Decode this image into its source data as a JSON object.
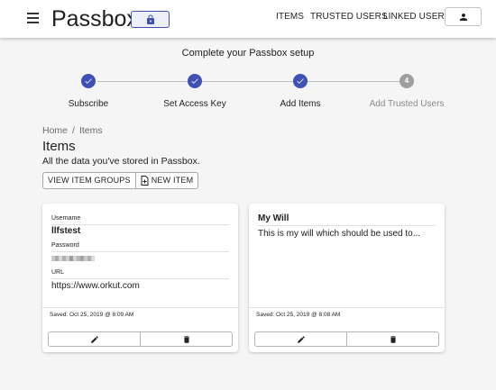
{
  "header": {
    "brand": "Passbox",
    "nav": {
      "items": "ITEMS",
      "trusted_users": "TRUSTED USERS",
      "linked_users": "LINKED USERS"
    }
  },
  "setup": {
    "title": "Complete your Passbox setup",
    "steps": [
      {
        "label": "Subscribe",
        "state": "done"
      },
      {
        "label": "Set Access Key",
        "state": "done"
      },
      {
        "label": "Add Items",
        "state": "done"
      },
      {
        "label": "Add Trusted Users",
        "state": "pending",
        "number": "4"
      }
    ]
  },
  "breadcrumb": {
    "home": "Home",
    "separator": "/",
    "current": "Items"
  },
  "page": {
    "title": "Items",
    "subtitle": "All the data you've stored in Passbox.",
    "actions": {
      "view_groups": "VIEW ITEM GROUPS",
      "new_item": "NEW ITEM"
    }
  },
  "cards": [
    {
      "fields": [
        {
          "label": "Username",
          "value": "llfstest"
        },
        {
          "label": "Password",
          "value": ""
        },
        {
          "label": "URL",
          "value": "https://www.orkut.com"
        }
      ],
      "saved": "Saved: Oct 25, 2019 @ 8:09 AM"
    },
    {
      "title": "My Will",
      "body": "This is my will which should be used to...",
      "saved": "Saved: Oct 25, 2019 @ 8:08 AM"
    }
  ],
  "colors": {
    "primary": "#3f51b5",
    "pending_step": "#9e9e9e",
    "background": "#f5f5f5"
  },
  "icons": [
    "menu-icon",
    "lock-icon",
    "account-icon",
    "check-icon",
    "new-file-icon",
    "edit-icon",
    "delete-icon"
  ]
}
